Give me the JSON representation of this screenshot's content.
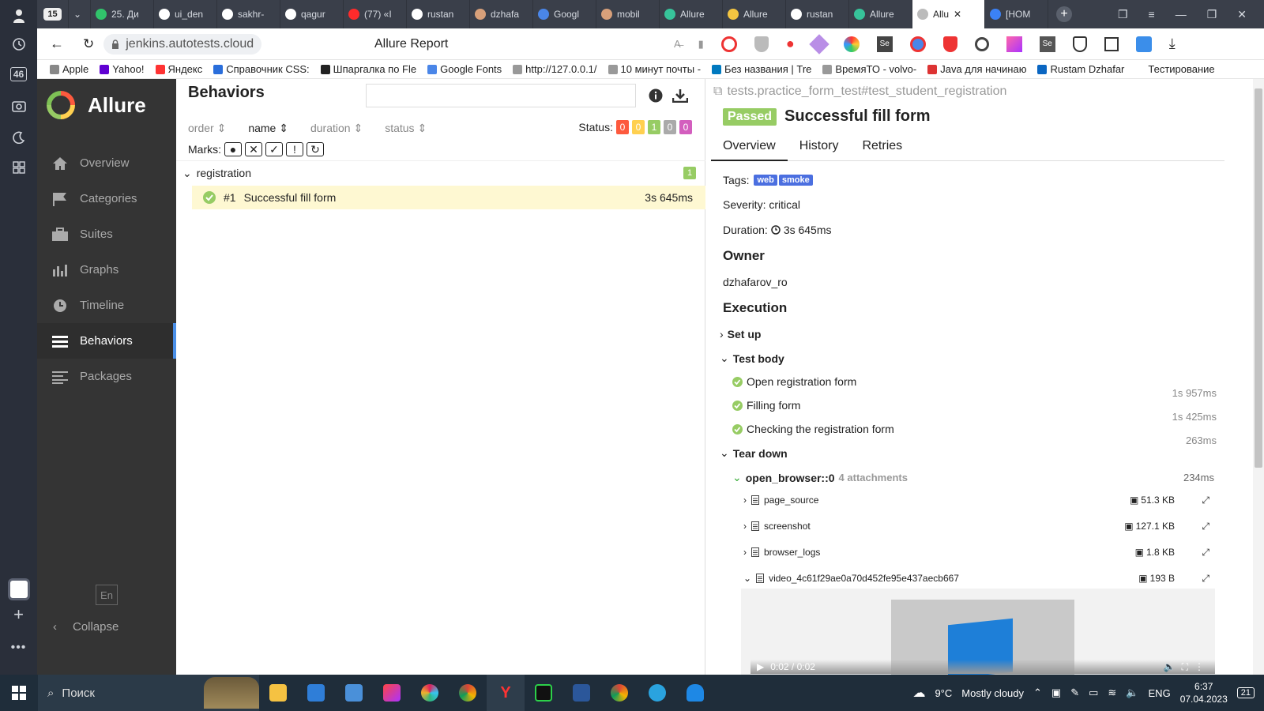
{
  "browser": {
    "tab_count_badge": "15",
    "sidebar_badge": "46",
    "tabs": [
      {
        "label": "25. Ди",
        "color": "#31c36b"
      },
      {
        "label": "ui_den",
        "color": "#ffffff"
      },
      {
        "label": "sakhr-",
        "color": "#ffffff"
      },
      {
        "label": "qagur",
        "color": "#ffffff"
      },
      {
        "label": "(77) «I",
        "color": "#ff2b2b"
      },
      {
        "label": "rustan",
        "color": "#ffffff"
      },
      {
        "label": "dzhafa",
        "color": "#d8a07a"
      },
      {
        "label": "Googl",
        "color": "#4a86e8"
      },
      {
        "label": "mobil",
        "color": "#d8a07a"
      },
      {
        "label": "Allure",
        "color": "#37c39a"
      },
      {
        "label": "Allure",
        "color": "#f3c541"
      },
      {
        "label": "rustan",
        "color": "#ffffff"
      },
      {
        "label": "Allure",
        "color": "#37c39a"
      },
      {
        "label": "Allu",
        "color": "#bbbbbb"
      },
      {
        "label": "[HOM",
        "color": "#3b82f6"
      }
    ],
    "url": "jenkins.autotests.cloud",
    "page_title": "Allure Report",
    "bookmarks": [
      {
        "label": "Apple",
        "color": "#888888"
      },
      {
        "label": "Yahoo!",
        "color": "#6001d2"
      },
      {
        "label": "Яндекс",
        "color": "#f33"
      },
      {
        "label": "Справочник CSS:",
        "color": "#2a6edb"
      },
      {
        "label": "Шпаргалка по Fle",
        "color": "#222222"
      },
      {
        "label": "Google Fonts",
        "color": "#4a86e8"
      },
      {
        "label": "http://127.0.0.1/",
        "color": "#999999"
      },
      {
        "label": "10 минут почты -",
        "color": "#999999"
      },
      {
        "label": "Без названия | Tre",
        "color": "#0079bf"
      },
      {
        "label": "ВремяТО - volvo-",
        "color": "#999999"
      },
      {
        "label": "Java для начинаю",
        "color": "#d33"
      },
      {
        "label": "Rustam Dzhafar",
        "color": "#0a66c2"
      },
      {
        "label": "Тестирование",
        "color": "#ffffff"
      }
    ]
  },
  "allure": {
    "brand": "Allure",
    "nav": [
      {
        "label": "Overview",
        "icon": "home-icon"
      },
      {
        "label": "Categories",
        "icon": "flag-icon"
      },
      {
        "label": "Suites",
        "icon": "briefcase-icon"
      },
      {
        "label": "Graphs",
        "icon": "bar-chart-icon"
      },
      {
        "label": "Timeline",
        "icon": "clock-icon"
      },
      {
        "label": "Behaviors",
        "icon": "list-icon",
        "active": true
      },
      {
        "label": "Packages",
        "icon": "align-left-icon"
      }
    ],
    "lang": "En",
    "collapse": "Collapse"
  },
  "behaviors": {
    "title": "Behaviors",
    "search_value": "",
    "sort": {
      "order": "order",
      "name": "name",
      "duration": "duration",
      "status": "status"
    },
    "status_label": "Status:",
    "status_counts": [
      {
        "value": "0",
        "color": "#fd5a3e"
      },
      {
        "value": "0",
        "color": "#ffd050"
      },
      {
        "value": "1",
        "color": "#97cc64"
      },
      {
        "value": "0",
        "color": "#aaaaaa"
      },
      {
        "value": "0",
        "color": "#d35ebe"
      }
    ],
    "marks_label": "Marks:",
    "group": {
      "name": "registration",
      "count": "1"
    },
    "test": {
      "number": "#1",
      "name": "Successful fill form",
      "duration": "3s 645ms"
    }
  },
  "detail": {
    "path": "tests.practice_form_test#test_student_registration",
    "status": "Passed",
    "title": "Successful fill form",
    "tabs": [
      "Overview",
      "History",
      "Retries"
    ],
    "tags_label": "Tags:",
    "tags": [
      "web",
      "smoke"
    ],
    "severity": "Severity: critical",
    "duration_label": "Duration:",
    "duration": "3s 645ms",
    "owner_heading": "Owner",
    "owner": "dzhafarov_ro",
    "execution_heading": "Execution",
    "setup": "Set up",
    "test_body": "Test body",
    "steps": [
      {
        "name": "Open registration form",
        "duration": "1s 957ms"
      },
      {
        "name": "Filling form",
        "duration": "1s 425ms"
      },
      {
        "name": "Checking the registration form",
        "duration": "263ms"
      }
    ],
    "teardown": "Tear down",
    "fixture": {
      "name": "open_browser::0",
      "attachments": "4 attachments",
      "duration": "234ms"
    },
    "attachments": [
      {
        "name": "page_source",
        "size": "51.3 KB"
      },
      {
        "name": "screenshot",
        "size": "127.1 KB"
      },
      {
        "name": "browser_logs",
        "size": "1.8 KB"
      },
      {
        "name": "video_4c61f29ae0a70d452fe95e437aecb667",
        "size": "193 B"
      }
    ],
    "video_time": "0:02 / 0:02"
  },
  "taskbar": {
    "search": "Поиск",
    "weather_temp": "9°C",
    "weather_desc": "Mostly cloudy",
    "lang": "ENG",
    "time": "6:37",
    "date": "07.04.2023",
    "notifications": "21"
  }
}
